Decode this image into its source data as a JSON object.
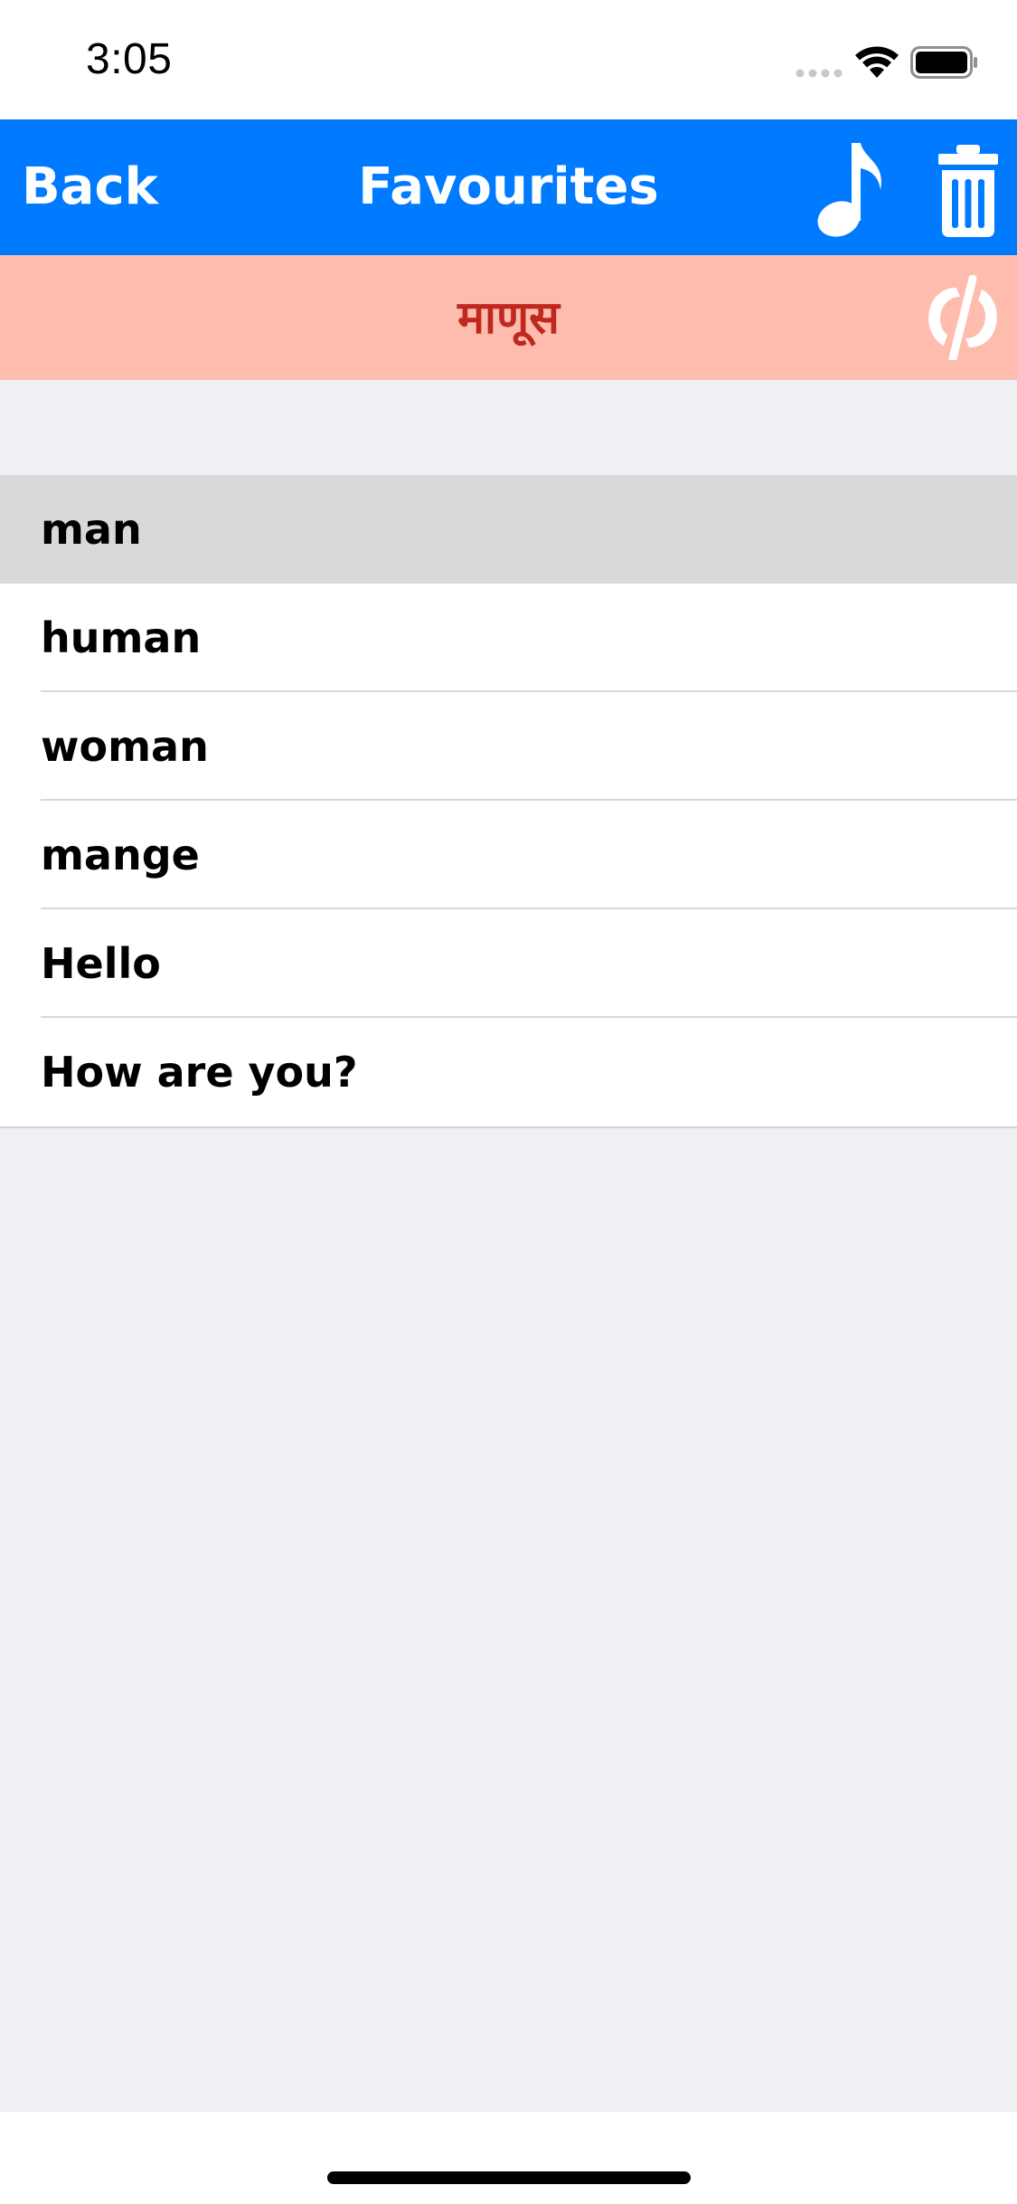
{
  "status": {
    "time": "3:05"
  },
  "nav": {
    "back_label": "Back",
    "title": "Favourites"
  },
  "banner": {
    "word": "माणूस"
  },
  "list": {
    "items": [
      {
        "label": "man",
        "selected": true
      },
      {
        "label": "human",
        "selected": false
      },
      {
        "label": "woman",
        "selected": false
      },
      {
        "label": "mange",
        "selected": false
      },
      {
        "label": "Hello",
        "selected": false
      },
      {
        "label": "How are you?",
        "selected": false
      }
    ]
  },
  "colors": {
    "nav_background": "#007aff",
    "banner_background": "#fdbcae",
    "banner_text": "#c0281e",
    "selected_row": "#d9d9d9",
    "page_background": "#efeff4"
  },
  "icons": {
    "music": "music-note-icon",
    "trash": "trash-icon",
    "swap": "swap-arrows-icon"
  }
}
